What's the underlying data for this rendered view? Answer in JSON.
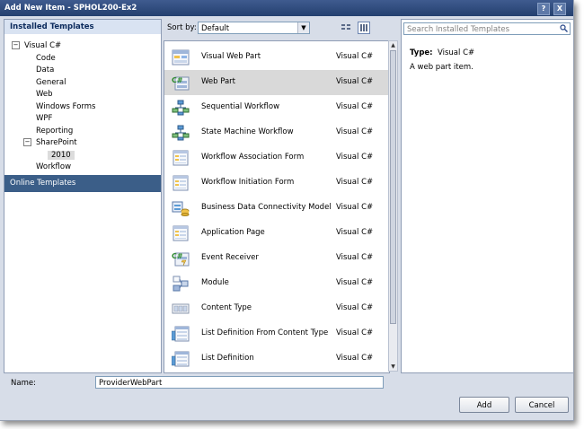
{
  "window": {
    "title": "Add New Item - SPHOL200-Ex2",
    "help_glyph": "?",
    "close_glyph": "X"
  },
  "left_panel": {
    "header": "Installed Templates",
    "tree": {
      "root": {
        "label": "Visual C#",
        "expander": "−"
      },
      "children": [
        "Code",
        "Data",
        "General",
        "Web",
        "Windows Forms",
        "WPF",
        "Reporting"
      ],
      "sharepoint": {
        "label": "SharePoint",
        "expander": "−",
        "child": "2010"
      },
      "workflow": "Workflow"
    },
    "online_templates": "Online Templates"
  },
  "toolbar": {
    "sort_label": "Sort by:",
    "sort_value": "Default"
  },
  "templates": [
    {
      "name": "Visual Web Part",
      "lang": "Visual C#",
      "icon": "visual-web-part-icon"
    },
    {
      "name": "Web Part",
      "lang": "Visual C#",
      "icon": "web-part-icon",
      "selected": true
    },
    {
      "name": "Sequential Workflow",
      "lang": "Visual C#",
      "icon": "workflow-icon"
    },
    {
      "name": "State Machine Workflow",
      "lang": "Visual C#",
      "icon": "workflow-icon"
    },
    {
      "name": "Workflow Association Form",
      "lang": "Visual C#",
      "icon": "form-icon"
    },
    {
      "name": "Workflow Initiation Form",
      "lang": "Visual C#",
      "icon": "form-icon"
    },
    {
      "name": "Business Data Connectivity Model",
      "lang": "Visual C#",
      "icon": "bdc-model-icon"
    },
    {
      "name": "Application Page",
      "lang": "Visual C#",
      "icon": "form-icon"
    },
    {
      "name": "Event Receiver",
      "lang": "Visual C#",
      "icon": "event-receiver-icon"
    },
    {
      "name": "Module",
      "lang": "Visual C#",
      "icon": "module-icon"
    },
    {
      "name": "Content Type",
      "lang": "Visual C#",
      "icon": "content-type-icon"
    },
    {
      "name": "List Definition From Content Type",
      "lang": "Visual C#",
      "icon": "list-definition-icon"
    },
    {
      "name": "List Definition",
      "lang": "Visual C#",
      "icon": "list-definition-icon"
    }
  ],
  "details": {
    "search_placeholder": "Search Installed Templates",
    "type_label": "Type:",
    "type_value": "Visual C#",
    "description": "A web part item."
  },
  "bottom": {
    "name_label": "Name:",
    "name_value": "ProviderWebPart",
    "add_label": "Add",
    "cancel_label": "Cancel"
  },
  "colors": {
    "title_bar": "#24406f",
    "selection": "#3b5e88",
    "dialog_bg": "#d7dde8"
  }
}
